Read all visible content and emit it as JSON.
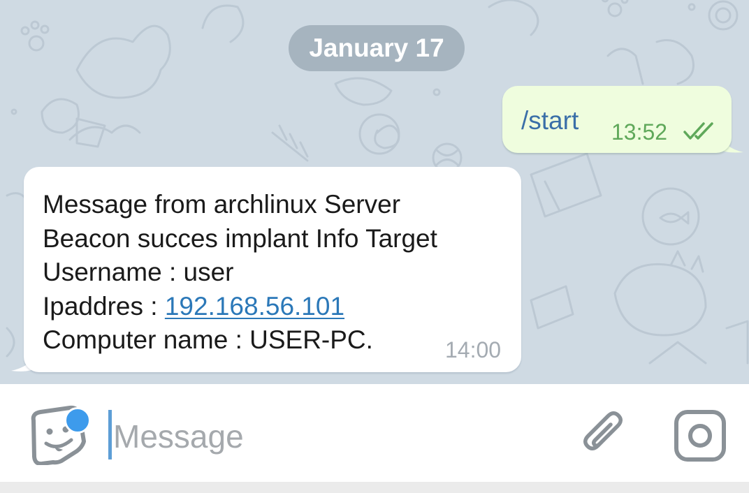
{
  "chat": {
    "date_label": "January 17",
    "outgoing": {
      "text": "/start",
      "time": "13:52",
      "status_icon": "double-check-icon"
    },
    "incoming": {
      "lines": {
        "l1": "Message from archlinux Server",
        "l2": "Beacon succes implant Info Target",
        "l3": "Username : user",
        "l4_label": "Ipaddres : ",
        "l4_link": "192.168.56.101",
        "l5": "Computer name : USER-PC."
      },
      "time": "14:00"
    }
  },
  "input_bar": {
    "placeholder": "Message",
    "value": "",
    "icons": {
      "emoji": "sticker-emoji-icon",
      "attach": "paperclip-icon",
      "camera": "camera-icon"
    }
  },
  "colors": {
    "chat_background": "#cfdae3",
    "outgoing_bubble": "#effdde",
    "incoming_bubble": "#ffffff",
    "link": "#2b78b8",
    "accent": "#3d9bec",
    "read_check": "#5fa85a"
  }
}
